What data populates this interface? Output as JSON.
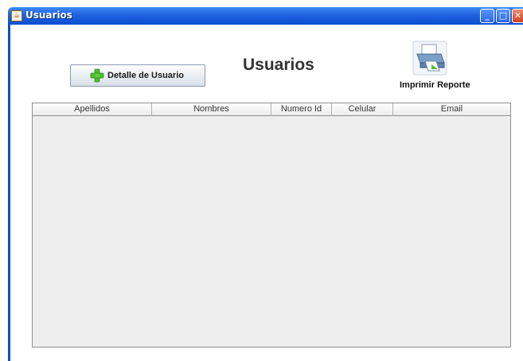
{
  "window": {
    "title": "Usuarios",
    "controls": [
      "minimize-icon",
      "maximize-icon",
      "close-icon"
    ]
  },
  "toolbar": {
    "detail_button_label": "Detalle de Usuario",
    "detail_button_icon": "plus-icon",
    "print_label": "Imprimir Reporte",
    "print_icon": "printer-icon"
  },
  "page": {
    "heading": "Usuarios"
  },
  "table": {
    "columns": [
      "Apellidos",
      "Nombres",
      "Numero Id",
      "Celular",
      "Email"
    ],
    "rows": []
  },
  "colors": {
    "titlebar": "#0a4ed1",
    "table_background": "#eeeeee",
    "plus_icon": "#4cbf2e"
  }
}
